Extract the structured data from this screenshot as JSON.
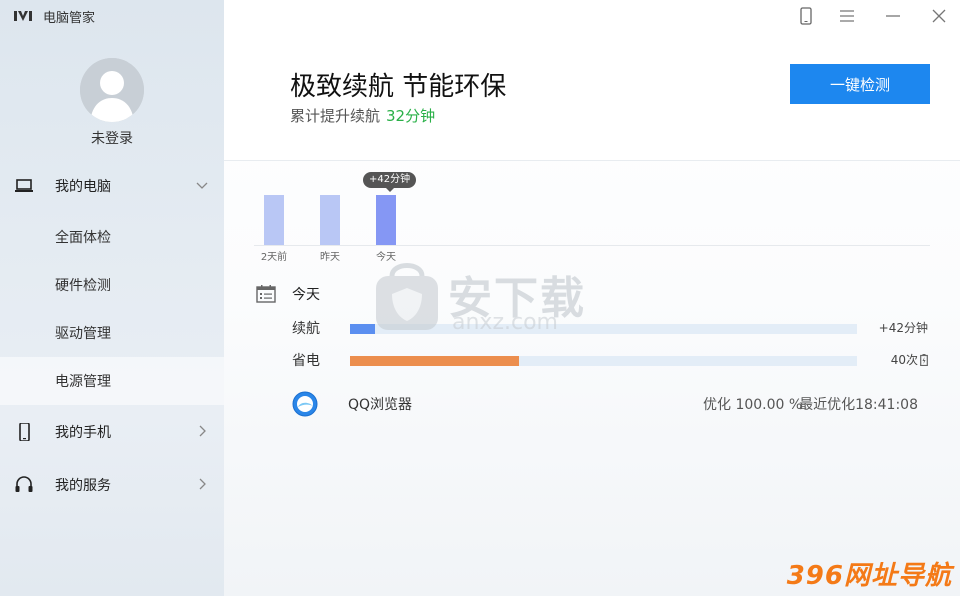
{
  "app": {
    "title": "电脑管家"
  },
  "user": {
    "status": "未登录"
  },
  "sidebar": {
    "groups": [
      {
        "label": "我的电脑",
        "icon": "laptop-icon",
        "chevron": "chevron-down-icon",
        "items": [
          "全面体检",
          "硬件检测",
          "驱动管理",
          "电源管理"
        ],
        "active": "电源管理"
      },
      {
        "label": "我的手机",
        "icon": "phone-icon",
        "chevron": "chevron-right-icon"
      },
      {
        "label": "我的服务",
        "icon": "headset-icon",
        "chevron": "chevron-right-icon"
      }
    ]
  },
  "header": {
    "headline": "极致续航 节能环保",
    "subline": "累计提升续航",
    "subline_value": "32分钟",
    "cta": "一键检测",
    "window_icons": [
      "phone-icon",
      "menu-icon",
      "minimize-icon",
      "close-icon"
    ]
  },
  "chart_data": {
    "type": "bar",
    "categories": [
      "2天前",
      "昨天",
      "今天"
    ],
    "values": [
      3,
      3,
      3
    ],
    "highlight": "今天",
    "tooltip": "+42分钟"
  },
  "today": {
    "label": "今天",
    "metrics": [
      {
        "label": "续航",
        "fraction": 0.05,
        "value": "+42分钟",
        "color": "#5b8ff0"
      },
      {
        "label": "省电",
        "fraction": 0.333,
        "value": "40次",
        "color": "#ec8e4e"
      }
    ],
    "app": {
      "name": "QQ浏览器",
      "optimize": "优化 100.00 %",
      "last": "最近优化18:41:08"
    }
  },
  "colors": {
    "accent": "#1d87ef",
    "green": "#2ab048",
    "bar": "#b9c7f5",
    "bar_active": "#8597f4"
  },
  "watermarks": {
    "center_text": "安下载",
    "center_url": "anxz.com",
    "corner": "396网址导航"
  }
}
